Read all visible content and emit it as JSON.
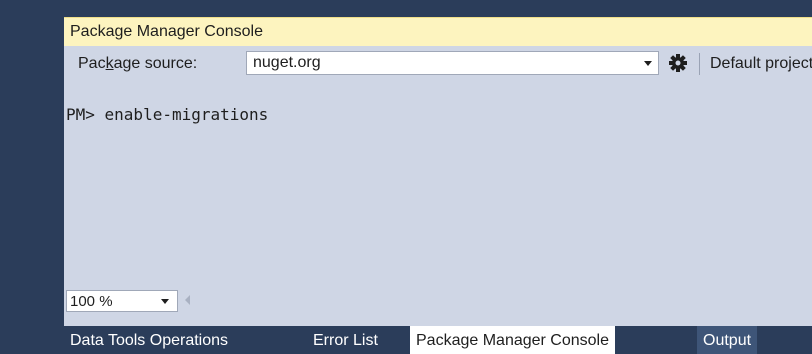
{
  "panel": {
    "title": "Package Manager Console"
  },
  "toolbar": {
    "source_label_pre": "Pac",
    "source_label_accel": "k",
    "source_label_post": "age source:",
    "source_value": "nuget.org",
    "settings_icon": "gear-icon",
    "project_label_pre": "Default pro",
    "project_label_accel": "j",
    "project_label_post": "ect:"
  },
  "console": {
    "lines": [
      "PM> enable-migrations"
    ]
  },
  "status": {
    "zoom_value": "100 %"
  },
  "tabs": [
    {
      "label": "Data Tools Operations"
    },
    {
      "label": "Error List"
    },
    {
      "label": "Package Manager Console"
    },
    {
      "label": "Output"
    }
  ],
  "colors": {
    "title_bar": "#fdf4bf",
    "panel_bg": "#cfd6e5",
    "chrome": "#2b3d5a",
    "active_tab": "#ffffff"
  }
}
